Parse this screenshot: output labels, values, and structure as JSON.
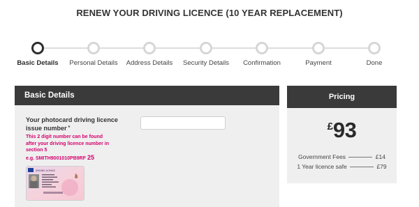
{
  "page": {
    "title": "RENEW YOUR DRIVING LICENCE (10 YEAR REPLACEMENT)"
  },
  "progress": {
    "steps": [
      {
        "label": "Basic Details",
        "active": true
      },
      {
        "label": "Personal Details",
        "active": false
      },
      {
        "label": "Address Details",
        "active": false
      },
      {
        "label": "Security Details",
        "active": false
      },
      {
        "label": "Confirmation",
        "active": false
      },
      {
        "label": "Payment",
        "active": false
      },
      {
        "label": "Done",
        "active": false
      }
    ]
  },
  "basic_details": {
    "header": "Basic Details",
    "field_label": "Your photocard driving licence issue number",
    "required_mark": "*",
    "hint": "This 2 digit number can be found after your driving licence number in section 5",
    "example_prefix": "e.g. SMITH9001010PB9RF",
    "example_number": "25",
    "input_value": "",
    "input_placeholder": "",
    "card_title": "DRIVING LICENCE"
  },
  "pricing": {
    "header": "Pricing",
    "currency": "£",
    "amount": "93",
    "fees": [
      {
        "label": "Government Fees",
        "value": "£14"
      },
      {
        "label": "1 Year licence safe",
        "value": "£79"
      }
    ]
  },
  "colors": {
    "accent": "#d6006e",
    "header_bg": "#3a3a3a",
    "panel_bg": "#efefef"
  }
}
